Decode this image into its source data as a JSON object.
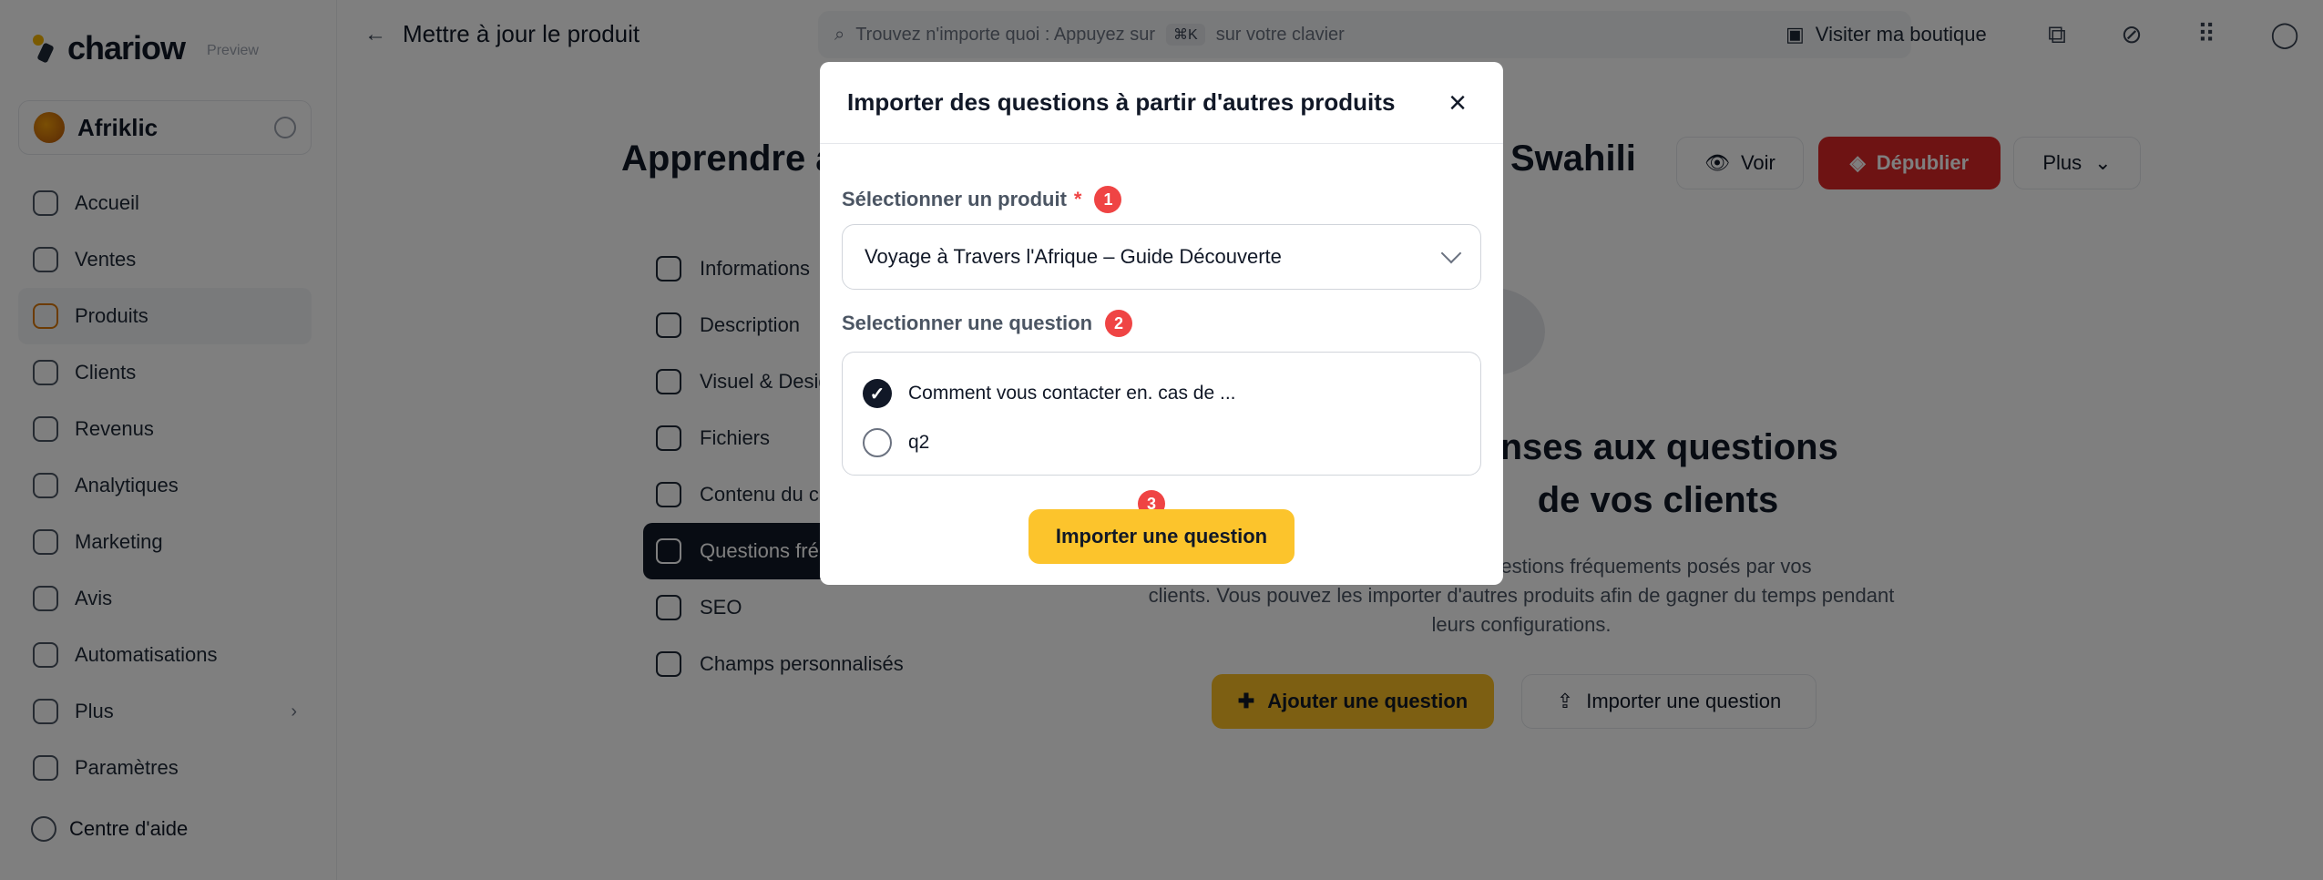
{
  "app": {
    "logo": "chariow",
    "badge": "Preview"
  },
  "store": {
    "name": "Afriklic"
  },
  "sidebar": {
    "items": [
      {
        "label": "Accueil",
        "icon": "home-icon"
      },
      {
        "label": "Ventes",
        "icon": "cart-icon"
      },
      {
        "label": "Produits",
        "icon": "box-icon",
        "active": true
      },
      {
        "label": "Clients",
        "icon": "users-icon"
      },
      {
        "label": "Revenus",
        "icon": "money-icon"
      },
      {
        "label": "Analytiques",
        "icon": "chart-icon"
      },
      {
        "label": "Marketing",
        "icon": "megaphone-icon"
      },
      {
        "label": "Avis",
        "icon": "star-icon"
      },
      {
        "label": "Automatisations",
        "icon": "bolt-icon"
      },
      {
        "label": "Plus",
        "icon": "more-icon"
      },
      {
        "label": "Paramètres",
        "icon": "gear-icon"
      }
    ],
    "help": "Centre d'aide"
  },
  "topbar": {
    "page_title": "Mettre à jour le produit",
    "search_placeholder": "Trouvez n'importe quoi : Appuyez sur",
    "search_kbd": "⌘K",
    "search_suffix": "sur votre clavier",
    "visit_label": "Visiter ma boutique"
  },
  "product": {
    "title_left": "Apprendre à",
    "title_right": "Swahili",
    "btn_voir": "Voir",
    "btn_depublier": "Dépublier",
    "btn_plus": "Plus"
  },
  "tabs": [
    {
      "label": "Informations"
    },
    {
      "label": "Description"
    },
    {
      "label": "Visuel & Design"
    },
    {
      "label": "Fichiers"
    },
    {
      "label": "Contenu du c"
    },
    {
      "label": "Questions fré",
      "active": true
    },
    {
      "label": "SEO"
    },
    {
      "label": "Champs personnalisés"
    }
  ],
  "empty_state": {
    "title_line1": "onses aux questions",
    "title_line2": "de vos clients",
    "desc_line1": "aux questions fréquements posés par vos",
    "desc_line2": "clients. Vous pouvez les importer d'autres produits afin de gagner du temps pendant",
    "desc_line3": "leurs configurations.",
    "btn_add": "Ajouter une question",
    "btn_import": "Importer une question"
  },
  "modal": {
    "title": "Importer des questions à partir d'autres produits",
    "product_label": "Sélectionner un produit",
    "required_mark": "*",
    "step1": "1",
    "product_value": "Voyage à Travers l'Afrique – Guide Découverte",
    "question_label": "Selectionner une question",
    "step2": "2",
    "questions": [
      {
        "label": "Comment vous contacter en. cas de ...",
        "checked": true
      },
      {
        "label": "q2",
        "checked": false
      }
    ],
    "step3": "3",
    "submit": "Importer une question"
  },
  "colors": {
    "accent_yellow": "#fcc42c",
    "danger_red": "#dc2626",
    "step_badge": "#ef4444",
    "overlay": "rgba(0,0,0,0.5)"
  }
}
